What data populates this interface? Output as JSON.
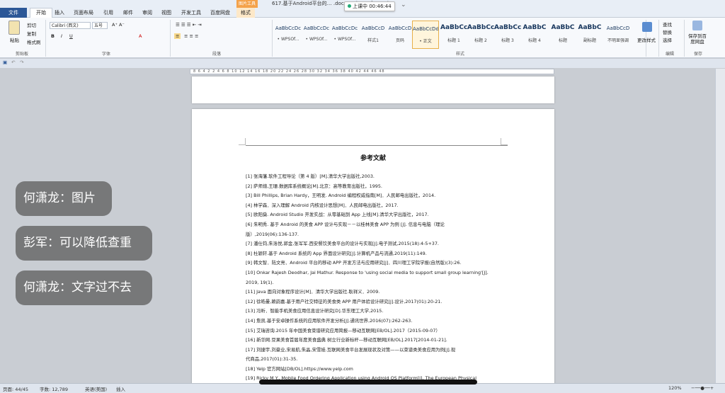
{
  "window": {
    "title": "617.基于Android平台的… .docx - Microsoft Word",
    "context_tab_group": "图片工具"
  },
  "recorder": {
    "label": "上课中 00:46:44",
    "close": "⌄"
  },
  "tabs": [
    "文件",
    "开始",
    "插入",
    "页面布局",
    "引用",
    "邮件",
    "审阅",
    "视图",
    "开发工具",
    "百度网盘",
    "格式"
  ],
  "ribbon": {
    "clipboard": {
      "paste": "粘贴",
      "cut": "剪切",
      "copy": "复制",
      "format_painter": "格式刷",
      "label": "剪贴板"
    },
    "font": {
      "name": "Calibri (西文)",
      "size": "五号",
      "label": "字体"
    },
    "paragraph": {
      "label": "段落"
    },
    "styles": {
      "label": "样式",
      "items": [
        {
          "sample": "AaBbCcDc",
          "name": "• WPSOf..."
        },
        {
          "sample": "AaBbCcDc",
          "name": "• WPSOf..."
        },
        {
          "sample": "AaBbCcDc",
          "name": "• WPSOf..."
        },
        {
          "sample": "AaBbCcD",
          "name": "样式1"
        },
        {
          "sample": "AaBbCcD",
          "name": "页码"
        },
        {
          "sample": "AaBbCcDd",
          "name": "• 正文"
        },
        {
          "sample": "AaBbCc",
          "name": "标题 1"
        },
        {
          "sample": "AaBbCc",
          "name": "标题 2"
        },
        {
          "sample": "AaBbCc",
          "name": "标题 3"
        },
        {
          "sample": "AaBbC",
          "name": "标题 4"
        },
        {
          "sample": "AaBbC",
          "name": "标题"
        },
        {
          "sample": "AaBbC",
          "name": "副标题"
        },
        {
          "sample": "AaBbCcD",
          "name": "不明显强调"
        }
      ]
    },
    "change_styles": "更改样式",
    "editing": {
      "find": "查找",
      "replace": "替换",
      "select": "选择",
      "label": "编辑"
    },
    "save": {
      "button": "保存到百度网盘",
      "label": "保存"
    }
  },
  "ruler": "8 6 4 2 2 4 6 8 10 12 14 16 18 20 22 24 26 28 30 32 34 36 38 40 42 44 46 48",
  "document": {
    "title": "参考文献",
    "references": [
      "[1]  张海藩.软件工程导论（第 4 版）[M].清华大学出版社,2003.",
      "[2]  萨师煊,王珊.数据库系统概论[M].北京：高等教育出版社，1995.",
      "[3]  Bill Phillips, Brian Hardy，王明发. Android 编程权威指南[M]．人民邮电出版社，2014.",
      "[4]  林学森．深入理解 Android 内核设计思想[M]．人民邮电出版社，2017.",
      "[5]  欧阳燊. Android Studio 开发实战：从零基础到 App 上线[M].清华大学出版社，2017.",
      "[6]  朱明秀. 基于 Android 的美食 APP 设计与实现－－以桂林美食 APP 为例 [J]. 信息与电脑（理论",
      "版）,2019(06):136-137.",
      "[7]  潘仕钧,朱洛悦,郭金,张军军.西安餐饮美食平台的设计与实现[J].电子测试,2015(18):4-5+37.",
      "[8]  杜颖轩.基于 Android 系统的 App 界面设计研究[J].计算机产品与流通,2019(11):149.",
      "[9]  韩文智．陆文亮．Android 平台的移动 APP 开发方法与应用研究[J]．四川理工学院学报(自然版)(3):26.",
      "[10] Onkar Rajesh Deodhar, Jai Mathur. Response to 'using social media to support small group learning'[J].",
      "2019, 19(1).",
      "[11]  Java 面向对象程序设计[M]．清华大学出版社.耿祥义．2009.",
      "[12]  徐皓曼,赖韵嘉.基于用户社交特征的美食类 APP 用户体验设计研究[J].设计,2017(01):20-21.",
      "[13]  冯昕．智能手机美食应用信息设计研究[D].华东理工大学,2015.",
      "[14]  詹凯.基于安卓操作系统的应用软件开发分析[J].通讯世界,2016(07):262-263.",
      "[15]  艾瑞咨询.2015 年中国美食菜谱研究应用简报—移动互联网[EB/OL].2017（2015-09-07）",
      "[16]  新华网.豆果美食首届年度美食盛典 树立行业新标杆—移动互联网[EB/OL].2017[2014-01-21].",
      "[17]  刘捷宇,刘豪业,宋易航,朱晶,宋雪娃.互联网美食平台发展现状及对策——以菜谱类美食应用为例[J].现",
      "代商品,2017(01):31-35.",
      "[18]  Yelp 官方网站[DB/OL].https://www.yelp.com",
      "[19]  Ricky M Y., Mobile Food Ordering Application using Android OS Platform[J]. The European Physical"
    ]
  },
  "status": {
    "page": "页面: 44/45",
    "words": "字数: 12,789",
    "lang": "英语(美国)",
    "insert": "插入",
    "zoom": "120%"
  },
  "chat": [
    {
      "text": "何潇龙：图片"
    },
    {
      "text": "彭军：可以降低查重"
    },
    {
      "text": "何潇龙：文字过不去"
    }
  ]
}
